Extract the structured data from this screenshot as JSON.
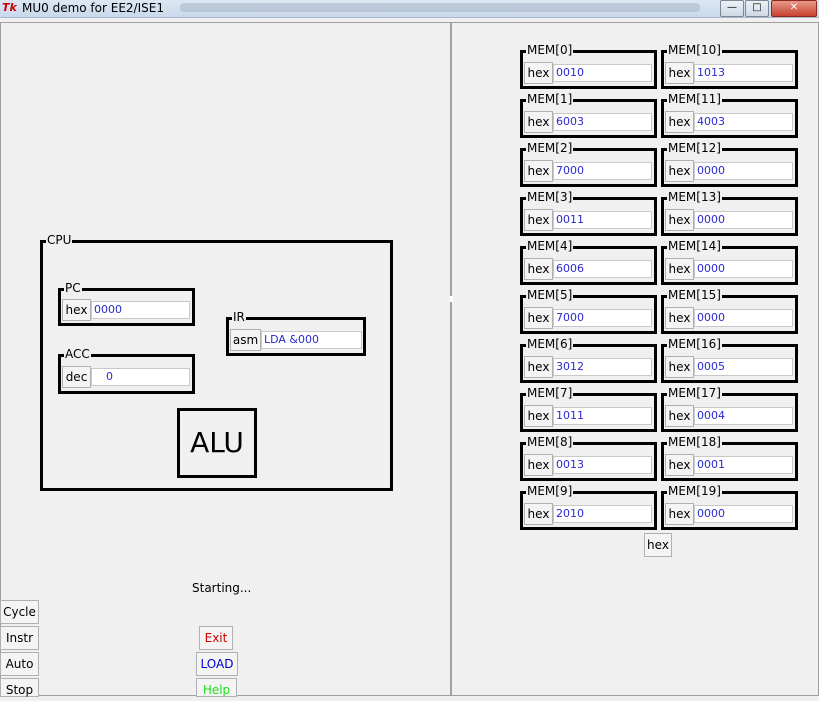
{
  "window": {
    "title": "MU0 demo for EE2/ISE1",
    "logo": "Tk",
    "min": "—",
    "max": "□",
    "close": "✕"
  },
  "cpu": {
    "label": "CPU",
    "pc": {
      "label": "PC",
      "mode": "hex",
      "value": "0000"
    },
    "acc": {
      "label": "ACC",
      "mode": "dec",
      "value": "0"
    },
    "ir": {
      "label": "IR",
      "mode": "asm",
      "value": "LDA &000"
    },
    "alu": "ALU"
  },
  "memory": [
    {
      "label": "MEM[0]",
      "mode": "hex",
      "value": "0010"
    },
    {
      "label": "MEM[1]",
      "mode": "hex",
      "value": "6003"
    },
    {
      "label": "MEM[2]",
      "mode": "hex",
      "value": "7000"
    },
    {
      "label": "MEM[3]",
      "mode": "hex",
      "value": "0011"
    },
    {
      "label": "MEM[4]",
      "mode": "hex",
      "value": "6006"
    },
    {
      "label": "MEM[5]",
      "mode": "hex",
      "value": "7000"
    },
    {
      "label": "MEM[6]",
      "mode": "hex",
      "value": "3012"
    },
    {
      "label": "MEM[7]",
      "mode": "hex",
      "value": "1011"
    },
    {
      "label": "MEM[8]",
      "mode": "hex",
      "value": "0013"
    },
    {
      "label": "MEM[9]",
      "mode": "hex",
      "value": "2010"
    },
    {
      "label": "MEM[10]",
      "mode": "hex",
      "value": "1013"
    },
    {
      "label": "MEM[11]",
      "mode": "hex",
      "value": "4003"
    },
    {
      "label": "MEM[12]",
      "mode": "hex",
      "value": "0000"
    },
    {
      "label": "MEM[13]",
      "mode": "hex",
      "value": "0000"
    },
    {
      "label": "MEM[14]",
      "mode": "hex",
      "value": "0000"
    },
    {
      "label": "MEM[15]",
      "mode": "hex",
      "value": "0000"
    },
    {
      "label": "MEM[16]",
      "mode": "hex",
      "value": "0005"
    },
    {
      "label": "MEM[17]",
      "mode": "hex",
      "value": "0004"
    },
    {
      "label": "MEM[18]",
      "mode": "hex",
      "value": "0001"
    },
    {
      "label": "MEM[19]",
      "mode": "hex",
      "value": "0000"
    }
  ],
  "memory_mode_button": "hex",
  "status": "Starting...",
  "controls": {
    "cycle": "Cycle",
    "instr": "Instr",
    "auto": "Auto",
    "stop": "Stop"
  },
  "actions": {
    "exit": {
      "label": "Exit",
      "color": "#cc0000"
    },
    "load": {
      "label": "LOAD",
      "color": "#0000cc"
    },
    "help": {
      "label": "Help",
      "color": "#22dd22"
    }
  }
}
